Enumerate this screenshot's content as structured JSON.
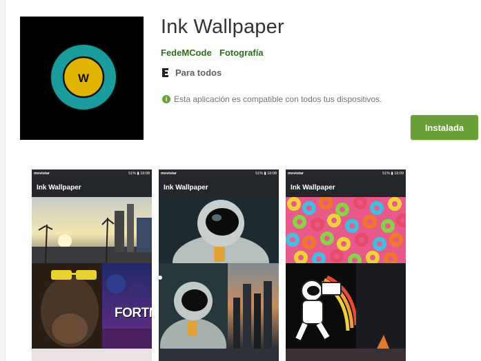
{
  "app": {
    "title": "Ink Wallpaper",
    "icon_letter": "W",
    "developer": "FedeMCode",
    "category": "Fotografía",
    "content_rating": "Para todos",
    "compatibility": "Esta aplicación es compatible con todos tus dispositivos.",
    "install_label": "Instalada"
  },
  "colors": {
    "accent_green": "#689f38",
    "link_green": "#33691e",
    "icon_ring": "#1b9c9c",
    "icon_center": "#e0b400"
  },
  "screenshots": [
    {
      "carrier": "movistar",
      "battery": "51%",
      "time": "19:08",
      "appbar_title": "Ink Wallpaper",
      "tiles": [
        "city-sunset",
        "monkey-sunglasses",
        "fortnite"
      ],
      "fortnite_text": "FORTNI"
    },
    {
      "carrier": "movistar",
      "battery": "51%",
      "time": "19:08",
      "appbar_title": "Ink Wallpaper",
      "tiles": [
        "astronaut-beer",
        "astronaut-beer-small",
        "city-skyline"
      ]
    },
    {
      "carrier": "movistar",
      "battery": "51%",
      "time": "19:09",
      "appbar_title": "Ink Wallpaper",
      "tiles": [
        "froot-loops",
        "astronaut-radio",
        "dark-abstract"
      ]
    }
  ],
  "icons": {
    "rating": "everyone-rating-icon",
    "info": "info-icon"
  }
}
